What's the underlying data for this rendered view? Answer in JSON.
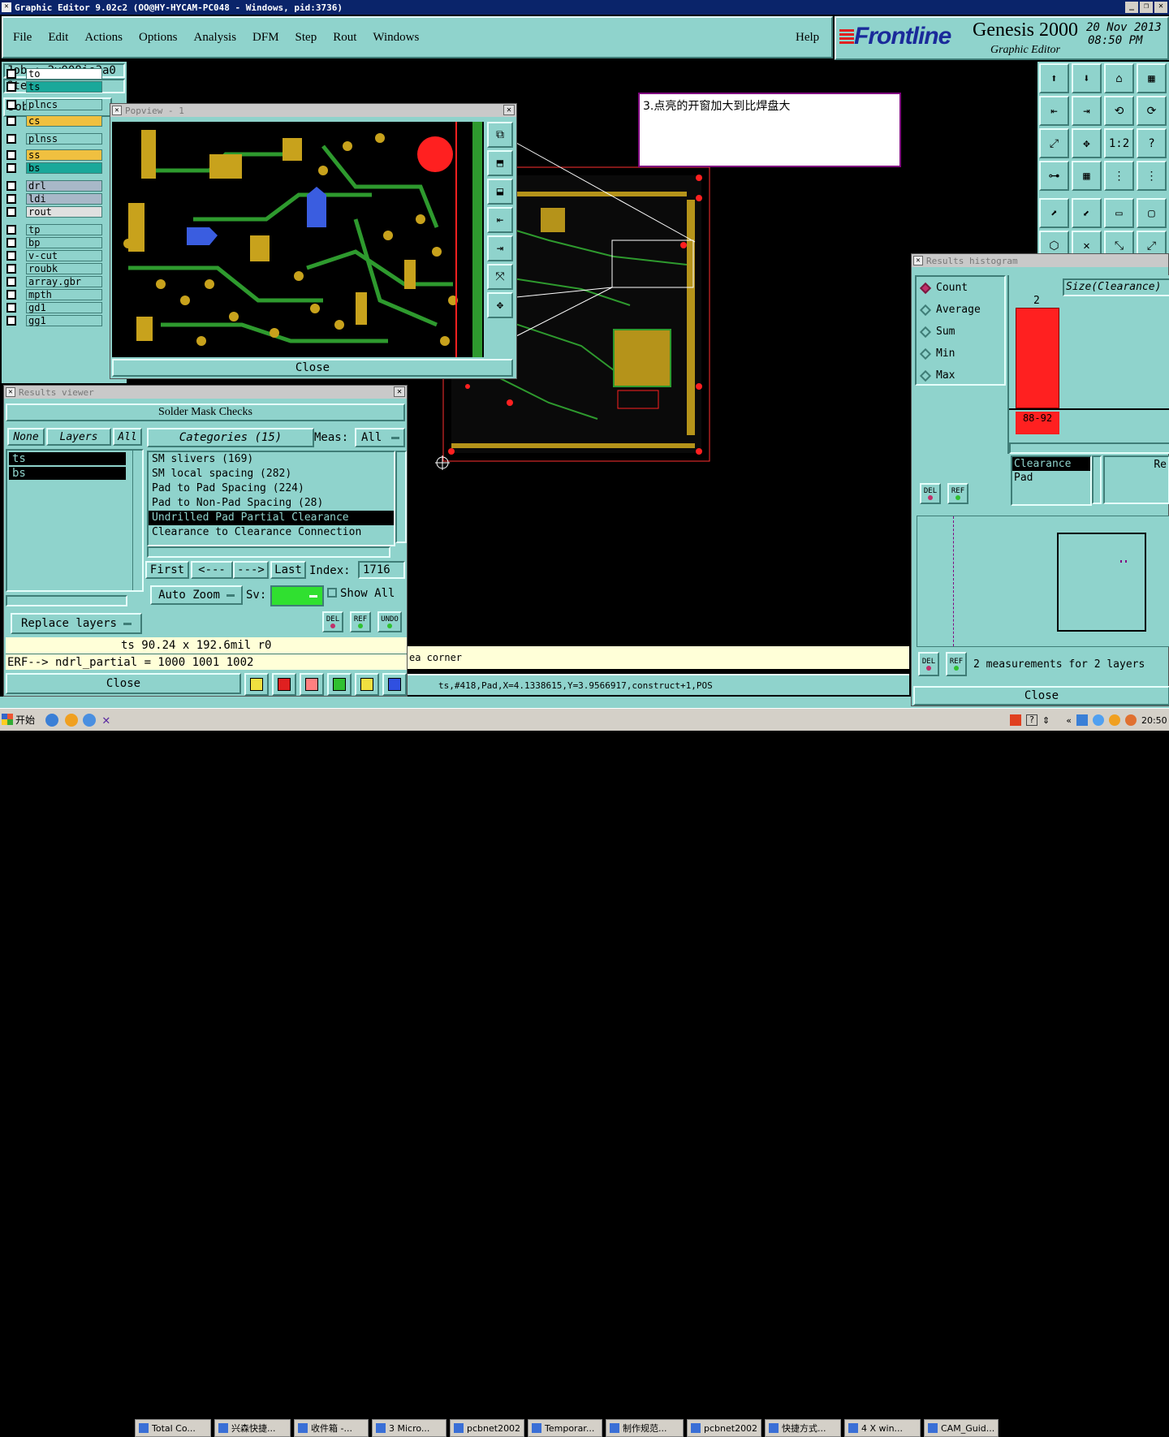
{
  "titlebar": {
    "title": "Graphic Editor 9.02c2 (OO@HY-HYCAM-PC048 - Windows, pid:3736)"
  },
  "menu": [
    "File",
    "Edit",
    "Actions",
    "Options",
    "Analysis",
    "DFM",
    "Step",
    "Rout",
    "Windows"
  ],
  "help": "Help",
  "brand": {
    "logo": "Frontline",
    "product": "Genesis 2000",
    "sub": "Graphic Editor",
    "date": "20 Nov 2013",
    "time": "08:50 PM"
  },
  "job": {
    "job_label": "Job : 2v008ie3a0",
    "step_label": "Step: cam",
    "matrix": "Job Matrix ..."
  },
  "layers": [
    "to",
    "ts",
    "plncs",
    "cs",
    "plnss",
    "ss",
    "bs",
    "drl",
    "ldi",
    "rout",
    "tp",
    "bp",
    "v-cut",
    "roubk",
    "array.gbr",
    "mpth",
    "gd1",
    "gg1"
  ],
  "annotation": "3.点亮的开窗加大到比焊盘大",
  "popview": {
    "title": "Popview - 1",
    "close": "Close"
  },
  "results_viewer": {
    "title": "Results viewer",
    "heading": "Solder Mask Checks",
    "none": "None",
    "layers": "Layers",
    "all": "All",
    "layer_items": [
      "ts",
      "bs"
    ],
    "categories_label": "Categories (15)",
    "meas_label": "Meas:",
    "meas_value": "All",
    "categories": [
      "SM slivers (169)",
      "SM local spacing (282)",
      "Pad to Pad Spacing (224)",
      "Pad to Non-Pad Spacing (28)",
      "Undrilled Pad Partial Clearance",
      "Clearance to Clearance Connection"
    ],
    "selected_index": 4,
    "first": "First",
    "prev": "<---",
    "next": "--->",
    "last": "Last",
    "index_label": "Index:",
    "index_value": "1716",
    "auto_zoom": "Auto Zoom",
    "sv_label": "Sv:",
    "show_all": "Show All",
    "replace_layers": "Replace layers",
    "del": "DEL",
    "ref": "REF",
    "undo": "UNDO",
    "measure": "ts 90.24 x 192.6mil  r0",
    "erf": "ERF--> ndrl_partial = 1000 1001 1002",
    "close": "Close"
  },
  "histogram": {
    "title": "Results histogram",
    "modes": [
      "Count",
      "Average",
      "Sum",
      "Min",
      "Max"
    ],
    "selected_mode": "Count",
    "size_label": "Size(Clearance)",
    "bar_value": 2,
    "bar_label": "88-92",
    "list_items": [
      "Clearance",
      "Pad"
    ],
    "re_label": "Re",
    "del": "DEL",
    "ref": "REF",
    "summary": "2 measurements for 2 layers",
    "close": "Close"
  },
  "status": {
    "left_msg": "ea corner",
    "coords": "ts,#418,Pad,X=4.1338615,Y=3.9566917,construct+1,POS"
  },
  "taskbar": {
    "start": "开始",
    "items": [
      "Total Co...",
      "兴森快捷...",
      "收件箱 -...",
      "3 Micro...",
      "pcbnet2002",
      "Temporar...",
      "制作规范...",
      "pcbnet2002",
      "快捷方式...",
      "4 X win...",
      "CAM_Guid..."
    ],
    "clock": "20:50"
  },
  "colors": {
    "teal": "#8fd3cc",
    "pad": "#c8a21c",
    "trace": "#2e9a2e",
    "red": "#ff2020"
  }
}
